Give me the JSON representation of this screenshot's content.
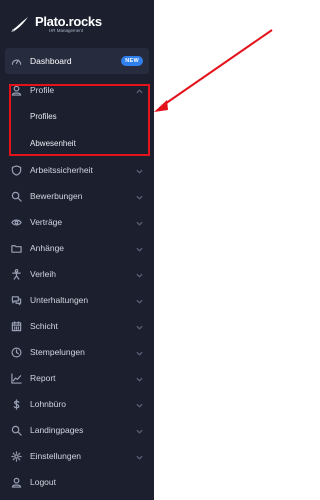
{
  "brand": {
    "name": "Plato.rocks",
    "subtitle": "HR Management"
  },
  "nav": {
    "dashboard": {
      "label": "Dashboard",
      "badge": "NEW",
      "icon": "gauge-icon"
    },
    "profile": {
      "label": "Profile",
      "icon": "user-icon",
      "expanded": true,
      "children": [
        {
          "label": "Profiles"
        },
        {
          "label": "Abwesenheit"
        }
      ]
    },
    "items": [
      {
        "label": "Arbeitssicherheit",
        "icon": "shield-icon"
      },
      {
        "label": "Bewerbungen",
        "icon": "search-user-icon"
      },
      {
        "label": "Verträge",
        "icon": "eye-icon"
      },
      {
        "label": "Anhänge",
        "icon": "folder-icon"
      },
      {
        "label": "Verleih",
        "icon": "person-icon"
      },
      {
        "label": "Unterhaltungen",
        "icon": "chat-icon"
      },
      {
        "label": "Schicht",
        "icon": "calendar-icon"
      },
      {
        "label": "Stempelungen",
        "icon": "clock-icon"
      },
      {
        "label": "Report",
        "icon": "chart-icon"
      },
      {
        "label": "Lohnbüro",
        "icon": "dollar-icon"
      },
      {
        "label": "Landingpages",
        "icon": "search-icon"
      },
      {
        "label": "Einstellungen",
        "icon": "gear-icon"
      }
    ],
    "logout": {
      "label": "Logout",
      "icon": "logout-icon"
    }
  },
  "colors": {
    "sidebar": "#1b1f2e",
    "badge": "#2f80ed",
    "highlight": "#e3121b"
  }
}
